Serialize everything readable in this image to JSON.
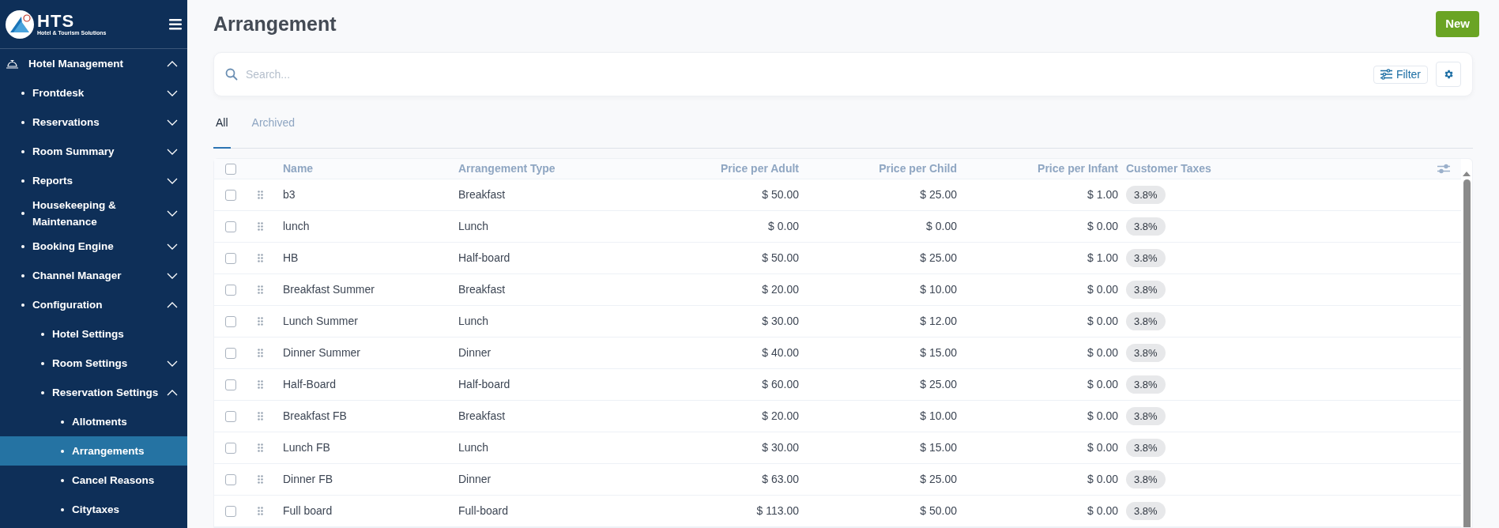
{
  "logo": {
    "name": "HTS",
    "tagline": "Hotel & Tourism Solutions"
  },
  "sidebar": {
    "items": [
      {
        "label": "Hotel Management",
        "expanded": true,
        "selected": false,
        "children": [
          {
            "label": "Frontdesk",
            "expanded": false,
            "selected": false
          },
          {
            "label": "Reservations",
            "expanded": false,
            "selected": false
          },
          {
            "label": "Room Summary",
            "expanded": false,
            "selected": false
          },
          {
            "label": "Reports",
            "expanded": false,
            "selected": false
          },
          {
            "label": "Housekeeping & Maintenance",
            "expanded": false,
            "selected": false
          },
          {
            "label": "Booking Engine",
            "expanded": false,
            "selected": false
          },
          {
            "label": "Channel Manager",
            "expanded": false,
            "selected": false
          },
          {
            "label": "Configuration",
            "expanded": true,
            "selected": false,
            "children": [
              {
                "label": "Hotel Settings",
                "selected": false
              },
              {
                "label": "Room Settings",
                "expanded": false,
                "selected": false
              },
              {
                "label": "Reservation Settings",
                "expanded": true,
                "selected": false,
                "children": [
                  {
                    "label": "Allotments",
                    "selected": false
                  },
                  {
                    "label": "Arrangements",
                    "selected": true
                  },
                  {
                    "label": "Cancel Reasons",
                    "selected": false
                  },
                  {
                    "label": "Citytaxes",
                    "selected": false
                  }
                ]
              }
            ]
          }
        ]
      }
    ]
  },
  "page": {
    "title": "Arrangement",
    "new_button": "New"
  },
  "search": {
    "placeholder": "Search...",
    "filter_button": "Filter"
  },
  "tabs": [
    {
      "label": "All",
      "selected": true
    },
    {
      "label": "Archived",
      "selected": false
    }
  ],
  "table": {
    "select_all_checked": false,
    "columns": [
      "Name",
      "Arrangement Type",
      "Price per Adult",
      "Price per Child",
      "Price per Infant",
      "Customer Taxes"
    ],
    "rows": [
      {
        "checked": false,
        "name": "b3",
        "type": "Breakfast",
        "adult": "$ 50.00",
        "child": "$ 25.00",
        "infant": "$ 1.00",
        "taxes": "3.8%"
      },
      {
        "checked": false,
        "name": "lunch",
        "type": "Lunch",
        "adult": "$ 0.00",
        "child": "$ 0.00",
        "infant": "$ 0.00",
        "taxes": "3.8%"
      },
      {
        "checked": false,
        "name": "HB",
        "type": "Half-board",
        "adult": "$ 50.00",
        "child": "$ 25.00",
        "infant": "$ 1.00",
        "taxes": "3.8%"
      },
      {
        "checked": false,
        "name": "Breakfast Summer",
        "type": "Breakfast",
        "adult": "$ 20.00",
        "child": "$ 10.00",
        "infant": "$ 0.00",
        "taxes": "3.8%"
      },
      {
        "checked": false,
        "name": "Lunch Summer",
        "type": "Lunch",
        "adult": "$ 30.00",
        "child": "$ 12.00",
        "infant": "$ 0.00",
        "taxes": "3.8%"
      },
      {
        "checked": false,
        "name": "Dinner Summer",
        "type": "Dinner",
        "adult": "$ 40.00",
        "child": "$ 15.00",
        "infant": "$ 0.00",
        "taxes": "3.8%"
      },
      {
        "checked": false,
        "name": "Half-Board",
        "type": "Half-board",
        "adult": "$ 60.00",
        "child": "$ 25.00",
        "infant": "$ 0.00",
        "taxes": "3.8%"
      },
      {
        "checked": false,
        "name": "Breakfast FB",
        "type": "Breakfast",
        "adult": "$ 20.00",
        "child": "$ 10.00",
        "infant": "$ 0.00",
        "taxes": "3.8%"
      },
      {
        "checked": false,
        "name": "Lunch FB",
        "type": "Lunch",
        "adult": "$ 30.00",
        "child": "$ 15.00",
        "infant": "$ 0.00",
        "taxes": "3.8%"
      },
      {
        "checked": false,
        "name": "Dinner FB",
        "type": "Dinner",
        "adult": "$ 63.00",
        "child": "$ 25.00",
        "infant": "$ 0.00",
        "taxes": "3.8%"
      },
      {
        "checked": false,
        "name": "Full board",
        "type": "Full-board",
        "adult": "$ 113.00",
        "child": "$ 50.00",
        "infant": "$ 0.00",
        "taxes": "3.8%"
      }
    ]
  }
}
